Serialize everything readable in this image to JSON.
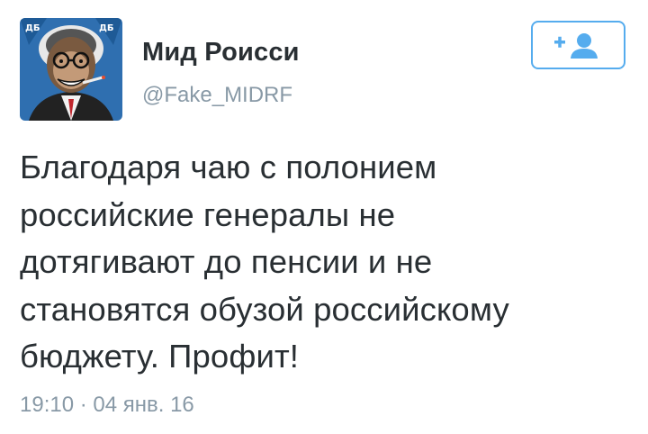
{
  "user": {
    "display_name": "Мид Роисси",
    "handle": "@Fake_MIDRF",
    "avatar_icon": "caricature-avatar-icon",
    "avatar_badges": [
      "ДБ",
      "ДБ"
    ]
  },
  "follow_button": {
    "icon": "follow-plus-user-icon",
    "label": "+"
  },
  "tweet": {
    "text": "Благодаря чаю с полонием\nроссийские генералы не\nдотягивают до пенсии и не\nстановятся обузой российскому\nбюджету. Профит!",
    "timestamp": "19:10 · 04 янв. 16"
  },
  "colors": {
    "accent": "#55acee",
    "text": "#292f33",
    "muted": "#8899a6",
    "avatar_bg": "#2f6fb0"
  }
}
